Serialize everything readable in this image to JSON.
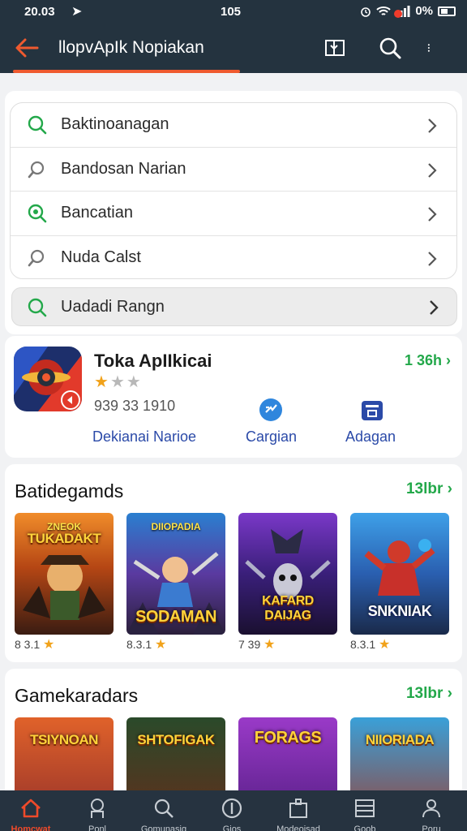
{
  "status": {
    "time": "20.03",
    "center": "105",
    "battery": "0%"
  },
  "topbar": {
    "title": "llopvApIk Nopiakan"
  },
  "suggestions": [
    {
      "text": "Baktinoanagan"
    },
    {
      "text": "Bandosan Narian"
    },
    {
      "text": "Bancatian"
    },
    {
      "text": "Nuda Calst"
    }
  ],
  "suggestion_highlight": {
    "text": "Uadadi Rangn"
  },
  "app": {
    "name": "Toka ApIIkicai",
    "rating_stars": 1,
    "max_stars": 3,
    "meta": "939 33 1910",
    "size": "1 36h",
    "actions": [
      {
        "label": "Dekianai Narioe"
      },
      {
        "label": "Cargian"
      },
      {
        "label": "Adagan"
      }
    ]
  },
  "sections": [
    {
      "title": "Batidegamds",
      "more": "13lbr",
      "games": [
        {
          "top": "ZNEOK",
          "label": "TUKADAKT",
          "rating": "8 3.1"
        },
        {
          "top": "DIIOPADIA",
          "label": "SODAMAN",
          "rating": "8.3.1"
        },
        {
          "top": "",
          "label": "KAFARD DAIJAG",
          "rating": "7 39"
        },
        {
          "top": "",
          "label": "SNKNIAK",
          "rating": "8.3.1"
        }
      ]
    },
    {
      "title": "Gamekaradars",
      "more": "13lbr",
      "games": [
        {
          "label": "TSIYNOAN"
        },
        {
          "label": "SHTOFIGAK"
        },
        {
          "label": "FORAGS"
        },
        {
          "label": "NIIORIADA"
        }
      ]
    }
  ],
  "bottomnav": [
    {
      "label": "Homcwat",
      "icon": "home-icon",
      "active": true
    },
    {
      "label": "Ponl",
      "icon": "robot-icon"
    },
    {
      "label": "Gomunasig",
      "icon": "search-icon"
    },
    {
      "label": "Gios",
      "icon": "info-icon"
    },
    {
      "label": "Modeoisad",
      "icon": "puzzle-icon"
    },
    {
      "label": "Goob",
      "icon": "list-icon"
    },
    {
      "label": "Poru",
      "icon": "profile-icon"
    }
  ],
  "colors": {
    "topbar": "#24333f",
    "accent": "#ef5a2f",
    "green": "#23a84a",
    "link": "#2b4aa8"
  }
}
